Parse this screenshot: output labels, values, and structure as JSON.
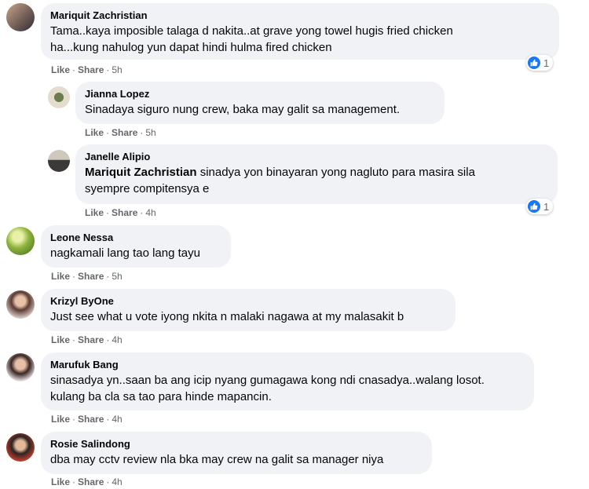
{
  "colors": {
    "bubble": "#f0f2f5",
    "meta": "#65676b",
    "like_blue": "#1877f2",
    "text": "#050505"
  },
  "actions": {
    "like": "Like",
    "share": "Share",
    "dot": "·"
  },
  "comments": [
    {
      "author": "Mariquit Zachristian",
      "lines": [
        "Tama..kaya imposible talaga d nakita..at grave yong towel hugis fried chicken",
        "ha...kung nahulog yun dapat hindi hulma fired chicken"
      ],
      "time": "5h",
      "reactions": "1",
      "reaction_icon": "like-icon"
    },
    {
      "author": "Jianna Lopez",
      "lines": [
        "Sinadaya siguro nung crew, baka may galit sa management."
      ],
      "time": "5h"
    },
    {
      "author": "Janelle Alipio",
      "mention": "Mariquit Zachristian",
      "lines": [
        " sinadya yon binayaran yong nagluto para masira sila",
        "syempre compitensya e"
      ],
      "time": "4h",
      "reactions": "1",
      "reaction_icon": "like-icon"
    },
    {
      "author": "Leone Nessa",
      "lines": [
        "nagkamali lang tao lang tayu"
      ],
      "time": "5h"
    },
    {
      "author": "Krizyl ByOne",
      "lines": [
        "Just see what u vote iyong nkita n malaki nagawa at my malasakit b"
      ],
      "time": "4h"
    },
    {
      "author": "Marufuk Bang",
      "lines": [
        "sinasadya yn..saan ba ang icip nyang gumagawa kong ndi cnasadya..walang losot.",
        "kulang ba cla sa tao para hinde mapancin."
      ],
      "time": "4h"
    },
    {
      "author": "Rosie Salindong",
      "lines": [
        "dba may cctv review nla bka may crew na galit sa manager niya"
      ],
      "time": "4h"
    }
  ]
}
